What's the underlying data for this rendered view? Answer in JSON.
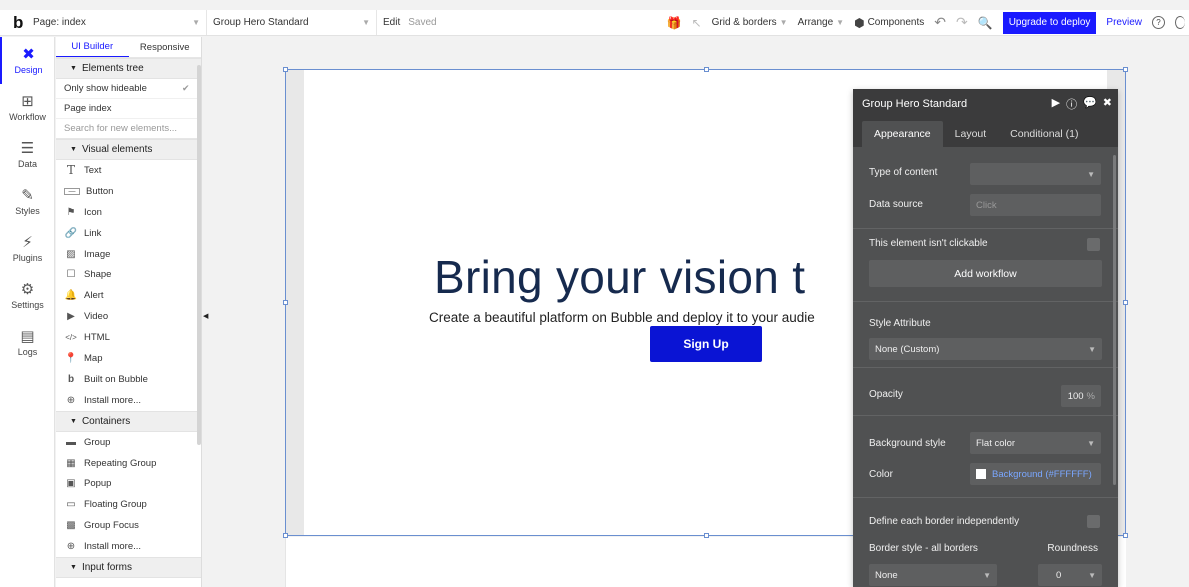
{
  "topbar": {
    "page_label": "Page: index",
    "element_label": "Group Hero Standard",
    "edit_label": "Edit",
    "saved_label": "Saved",
    "grid_label": "Grid & borders",
    "arrange_label": "Arrange",
    "components_label": "Components",
    "upgrade_label": "Upgrade to deploy",
    "preview_label": "Preview",
    "help_label": "?"
  },
  "leftnav": {
    "items": [
      {
        "label": "Design",
        "icon": "design-icon"
      },
      {
        "label": "Workflow",
        "icon": "workflow-icon"
      },
      {
        "label": "Data",
        "icon": "data-icon"
      },
      {
        "label": "Styles",
        "icon": "styles-icon"
      },
      {
        "label": "Plugins",
        "icon": "plugins-icon"
      },
      {
        "label": "Settings",
        "icon": "settings-icon"
      },
      {
        "label": "Logs",
        "icon": "logs-icon"
      }
    ]
  },
  "palette": {
    "tabs": [
      "UI Builder",
      "Responsive"
    ],
    "elements_tree_label": "Elements tree",
    "only_show_hideable": "Only show hideable",
    "page_index": "Page index",
    "search_placeholder": "Search for new elements...",
    "visual_label": "Visual elements",
    "visual": [
      "Text",
      "Button",
      "Icon",
      "Link",
      "Image",
      "Shape",
      "Alert",
      "Video",
      "HTML",
      "Map",
      "Built on Bubble",
      "Install more..."
    ],
    "containers_label": "Containers",
    "containers": [
      "Group",
      "Repeating Group",
      "Popup",
      "Floating Group",
      "Group Focus",
      "Install more..."
    ],
    "inputs_label": "Input forms"
  },
  "canvas": {
    "hero_title": "Bring your vision t",
    "hero_subtitle": "Create a beautiful platform on Bubble and deploy it to your audie",
    "cta_label": "Sign Up"
  },
  "props": {
    "title": "Group Hero Standard",
    "tabs": [
      "Appearance",
      "Layout",
      "Conditional (1)"
    ],
    "type_of_content_label": "Type of content",
    "data_source_label": "Data source",
    "data_source_placeholder": "Click",
    "not_clickable_label": "This element isn't clickable",
    "add_workflow_label": "Add workflow",
    "style_attribute_label": "Style Attribute",
    "style_attribute_value": "None (Custom)",
    "opacity_label": "Opacity",
    "opacity_value": "100",
    "opacity_unit": "%",
    "bg_style_label": "Background style",
    "bg_style_value": "Flat color",
    "color_label": "Color",
    "color_value": "Background (#FFFFFF)",
    "border_independent_label": "Define each border independently",
    "border_style_label": "Border style - all borders",
    "roundness_label": "Roundness",
    "border_style_value": "None",
    "roundness_value": "0"
  },
  "colors": {
    "accent": "#1a1aff",
    "cta": "#0a14d4",
    "panel": "#505152",
    "hero_text": "#162a4e"
  }
}
